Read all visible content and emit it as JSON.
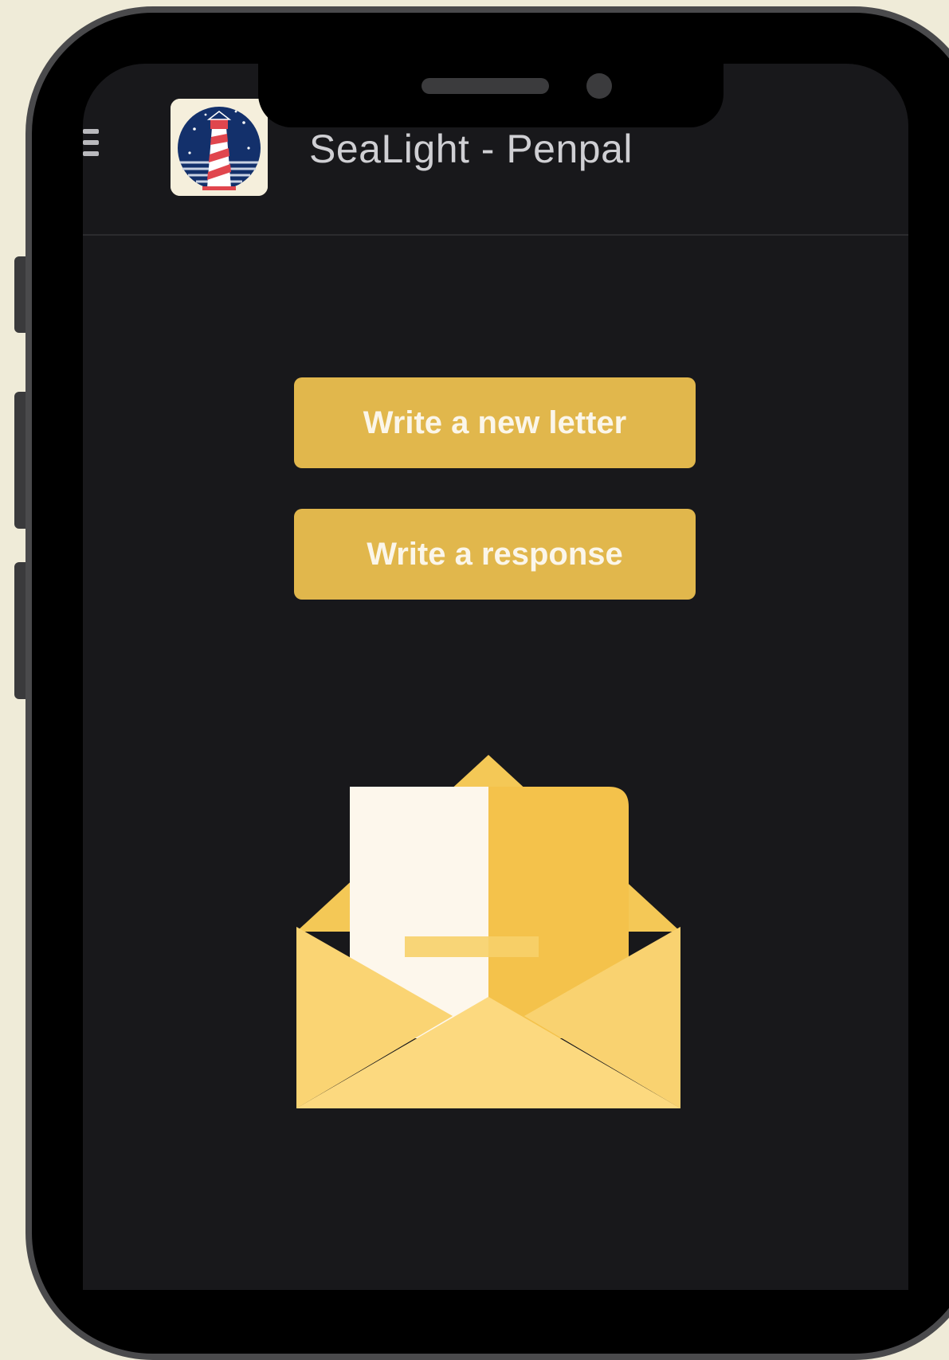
{
  "app": {
    "title": "SeaLight - Penpal",
    "logo_icon": "lighthouse-icon",
    "menu_icon": "hamburger-menu-icon"
  },
  "actions": {
    "new_letter_label": "Write a new letter",
    "response_label": "Write a response"
  },
  "illustration": {
    "icon": "open-envelope-icon"
  },
  "colors": {
    "background": "#18181b",
    "button": "#e1b74c",
    "button_text": "#fbf6ea",
    "title_text": "#cfcfd3",
    "envelope_light": "#fbd97f",
    "envelope_dark": "#f2c24c",
    "letter": "#fdf7ec"
  }
}
